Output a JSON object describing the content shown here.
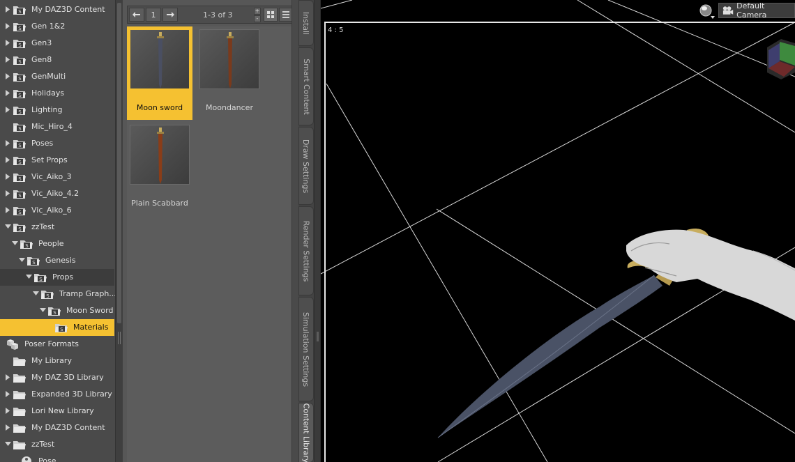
{
  "tree": {
    "items": [
      {
        "label": "My  DAZ3D Content",
        "level": 0,
        "arrow": "right",
        "icon": "folder-s"
      },
      {
        "label": "Gen 1&2",
        "level": 0,
        "arrow": "right",
        "icon": "folder-s"
      },
      {
        "label": "Gen3",
        "level": 0,
        "arrow": "right",
        "icon": "folder-s"
      },
      {
        "label": "Gen8",
        "level": 0,
        "arrow": "right",
        "icon": "folder-s"
      },
      {
        "label": "GenMulti",
        "level": 0,
        "arrow": "right",
        "icon": "folder-s"
      },
      {
        "label": "Holidays",
        "level": 0,
        "arrow": "right",
        "icon": "folder-s"
      },
      {
        "label": "Lighting",
        "level": 0,
        "arrow": "right",
        "icon": "folder-s"
      },
      {
        "label": "Mic_Hiro_4",
        "level": 0,
        "arrow": "none",
        "icon": "folder-s"
      },
      {
        "label": "Poses",
        "level": 0,
        "arrow": "right",
        "icon": "folder-s"
      },
      {
        "label": "Set Props",
        "level": 0,
        "arrow": "right",
        "icon": "folder-s"
      },
      {
        "label": "Vic_Aiko_3",
        "level": 0,
        "arrow": "right",
        "icon": "folder-s"
      },
      {
        "label": "Vic_Aiko_4.2",
        "level": 0,
        "arrow": "right",
        "icon": "folder-s"
      },
      {
        "label": "Vic_Aiko_6",
        "level": 0,
        "arrow": "right",
        "icon": "folder-s"
      },
      {
        "label": "zzTest",
        "level": 0,
        "arrow": "down",
        "icon": "folder-s"
      },
      {
        "label": "People",
        "level": 1,
        "arrow": "down",
        "icon": "folder-s"
      },
      {
        "label": "Genesis",
        "level": 2,
        "arrow": "down",
        "icon": "folder-s"
      },
      {
        "label": "Props",
        "level": 3,
        "arrow": "down",
        "icon": "folder-s",
        "state": "dark"
      },
      {
        "label": "Tramp Graph...",
        "level": 4,
        "arrow": "down",
        "icon": "folder-s"
      },
      {
        "label": "Moon Sword",
        "level": 5,
        "arrow": "down",
        "icon": "folder-s"
      },
      {
        "label": "Materials",
        "level": 6,
        "arrow": "none",
        "icon": "folder-s",
        "state": "yellow"
      },
      {
        "label": "Poser Formats",
        "level": -1,
        "arrow": "none",
        "icon": "boxes"
      },
      {
        "label": "My Library",
        "level": 0,
        "arrow": "none",
        "icon": "folder"
      },
      {
        "label": "My DAZ 3D Library",
        "level": 0,
        "arrow": "right",
        "icon": "folder"
      },
      {
        "label": "Expanded 3D Library",
        "level": 0,
        "arrow": "right",
        "icon": "folder"
      },
      {
        "label": "Lori New Library",
        "level": 0,
        "arrow": "right",
        "icon": "folder"
      },
      {
        "label": "My  DAZ3D Content",
        "level": 0,
        "arrow": "right",
        "icon": "folder"
      },
      {
        "label": "zzTest",
        "level": 0,
        "arrow": "down",
        "icon": "folder"
      },
      {
        "label": "Pose",
        "level": 1,
        "arrow": "none",
        "icon": "pose"
      }
    ]
  },
  "content": {
    "page": "1",
    "count": "1-3 of 3",
    "zoom_in": "+",
    "zoom_out": "-",
    "items": [
      {
        "name": "Moon sword",
        "selected": true,
        "blade": "#4a4f62"
      },
      {
        "name": "Moondancer",
        "selected": false,
        "blade": "#7a3a1c"
      },
      {
        "name": "Plain Scabbard",
        "selected": false,
        "blade": "#8a3d18"
      }
    ]
  },
  "tabs": [
    {
      "label": "Install",
      "active": false
    },
    {
      "label": "Smart Content",
      "active": false
    },
    {
      "label": "Draw Settings",
      "active": false
    },
    {
      "label": "Render Settings",
      "active": false
    },
    {
      "label": "Simulation Settings",
      "active": false
    },
    {
      "label": "Content Library",
      "active": true
    }
  ],
  "viewport": {
    "aspect": "4 : 5",
    "camera": "Default Camera"
  },
  "colors": {
    "selection": "#f5c131",
    "sword_blade": "#4a5266",
    "sword_guard": "#c8ad5e",
    "hand": "#d8d8d8"
  }
}
